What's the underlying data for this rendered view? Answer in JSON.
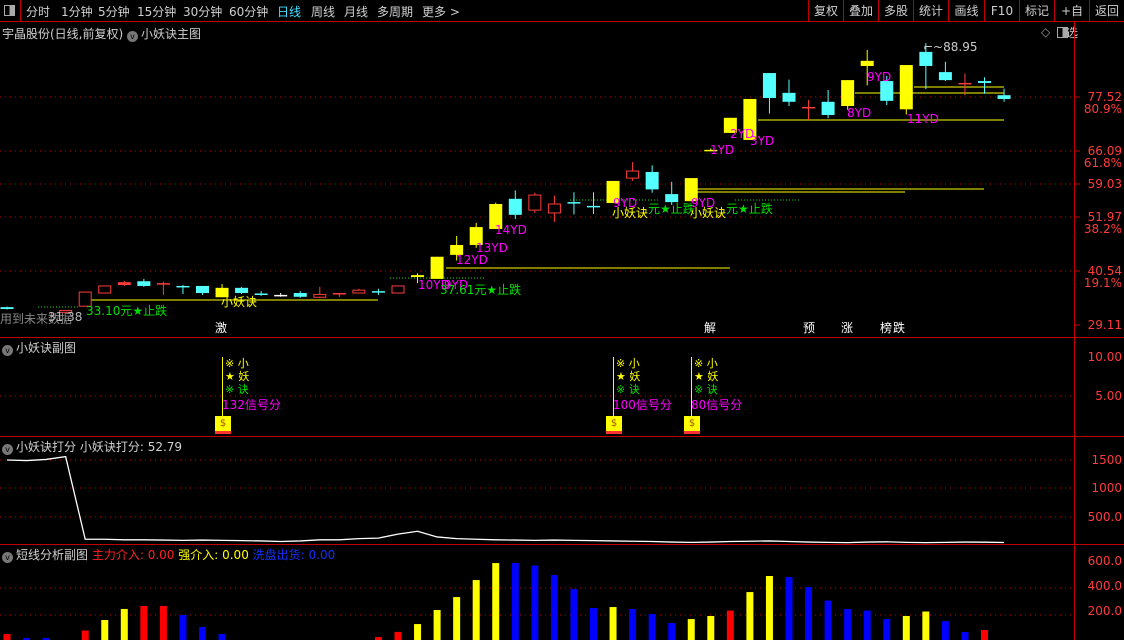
{
  "toolbar": {
    "periods": [
      "分时",
      "1分钟",
      "5分钟",
      "15分钟",
      "30分钟",
      "60分钟",
      "日线",
      "周线",
      "月线",
      "多周期",
      "更多 >"
    ],
    "active_period": "日线",
    "buttons": [
      "复权",
      "叠加",
      "多股",
      "统计",
      "画线",
      "F10",
      "标记",
      "+自选",
      "返回"
    ]
  },
  "main": {
    "stock_title": "宇晶股份(日线,前复权)",
    "indicator": "小妖诀主图",
    "price_axis": [
      "77.52",
      "80.9%",
      "66.09",
      "61.8%",
      "59.03",
      "51.97",
      "38.2%",
      "40.54",
      "19.1%",
      "29.11"
    ],
    "high_label": "88.95",
    "future_data_note": "用到未来数据",
    "low_label": "31.38",
    "labels": {
      "stop1": "33.10元★止跌",
      "xyj1": "小妖诀",
      "yd10": "10YD",
      "yd9a": "9YD",
      "stop2": "37.61元★止跌",
      "yd12": "12YD",
      "yd13": "13YD",
      "yd14": "14YD",
      "yd9b": "9YD",
      "xyj2": "小妖诀",
      "stop3": "元★止跌",
      "yd9c": "9YD",
      "xyj3": "小妖诀",
      "stop4": "元★止跌",
      "yd1": "1YD",
      "yd2": "2YD",
      "yd3": "3YD",
      "yd8": "8YD",
      "yd9d": "9YD",
      "yd11": "11YD"
    },
    "markers": [
      {
        "text": "激",
        "color": "#c04000"
      },
      {
        "text": "解",
        "color": "#008080"
      },
      {
        "text": "预",
        "color": "#a04000"
      },
      {
        "text": "涨",
        "color": "#900000"
      },
      {
        "text": "榜",
        "color": "#804000"
      },
      {
        "text": "跌",
        "color": "#008000"
      }
    ]
  },
  "sub1": {
    "title": "小妖诀副图",
    "axis": [
      "10.00",
      "5.00"
    ],
    "signal_lines": [
      "小",
      "妖",
      "诀"
    ],
    "signals": [
      {
        "index": 11,
        "score": "132信号分"
      },
      {
        "index": 31,
        "score": "100信号分"
      },
      {
        "index": 35,
        "score": "80信号分"
      }
    ]
  },
  "sub2": {
    "title": "小妖诀打分",
    "value_label": "小妖诀打分: 52.79",
    "axis": [
      "1500",
      "1000",
      "500.0"
    ]
  },
  "sub3": {
    "title": "短线分析副图",
    "main_in": "主力介入: 0.00",
    "strong_in": "强介入: 0.00",
    "wash_out": "洗盘出货: 0.00",
    "axis": [
      "600.0",
      "400.0",
      "200.0"
    ]
  },
  "colors": {
    "up": "#ff3c3c",
    "down": "#54ffff",
    "yellow": "#ffff00",
    "blue": "#0000ff",
    "grid": "#c00000"
  },
  "chart_data": [
    {
      "type": "candlestick",
      "name": "小妖诀主图",
      "ylim": [
        29.11,
        88.95
      ],
      "candles": [
        [
          0,
          32.9,
          32.5,
          33.0,
          32.4,
          "C"
        ],
        [
          3,
          32.2,
          31.8,
          32.3,
          31.6,
          "R"
        ],
        [
          4,
          36.1,
          33.1,
          36.1,
          33.1,
          "R"
        ],
        [
          5,
          37.4,
          35.9,
          37.4,
          35.9,
          "R"
        ],
        [
          6,
          38.2,
          37.6,
          38.5,
          37.4,
          "F"
        ],
        [
          7,
          38.4,
          37.4,
          38.9,
          37.2,
          "C"
        ],
        [
          8,
          38.0,
          37.8,
          38.3,
          35.5,
          "F"
        ],
        [
          9,
          37.4,
          37.3,
          37.6,
          35.7,
          "C"
        ],
        [
          10,
          37.4,
          35.9,
          37.4,
          35.5,
          "C"
        ],
        [
          11,
          37.0,
          35.0,
          37.8,
          35.0,
          "Y"
        ],
        [
          12,
          37.0,
          35.9,
          37.2,
          35.7,
          "C"
        ],
        [
          13,
          35.8,
          35.7,
          36.3,
          35.3,
          "C"
        ],
        [
          14,
          35.5,
          35.4,
          35.9,
          35.1,
          "W"
        ],
        [
          15,
          35.9,
          35.1,
          36.3,
          34.9,
          "C"
        ],
        [
          16,
          35.6,
          35.0,
          37.2,
          34.8,
          "R"
        ],
        [
          17,
          35.9,
          35.6,
          35.9,
          35.1,
          "F"
        ],
        [
          18,
          36.5,
          35.9,
          36.8,
          35.8,
          "R"
        ],
        [
          19,
          36.3,
          36.2,
          36.8,
          35.5,
          "C"
        ],
        [
          20,
          37.4,
          35.9,
          37.4,
          35.9,
          "R"
        ],
        [
          21,
          39.7,
          39.3,
          40.1,
          38.0,
          "Y"
        ],
        [
          22,
          43.6,
          38.9,
          43.6,
          38.9,
          "Y"
        ],
        [
          23,
          46.1,
          44.0,
          48.0,
          42.8,
          "Y"
        ],
        [
          24,
          49.9,
          46.1,
          50.8,
          45.5,
          "Y"
        ],
        [
          25,
          54.8,
          49.5,
          55.1,
          49.5,
          "Y"
        ],
        [
          26,
          55.9,
          52.5,
          57.7,
          51.6,
          "C"
        ],
        [
          27,
          56.7,
          53.5,
          57.2,
          52.9,
          "R"
        ],
        [
          28,
          54.8,
          52.9,
          56.6,
          51.0,
          "R"
        ],
        [
          29,
          55.2,
          55.0,
          57.3,
          52.6,
          "C"
        ],
        [
          30,
          54.4,
          54.2,
          57.3,
          52.7,
          "C"
        ],
        [
          31,
          59.7,
          55.0,
          59.7,
          55.0,
          "Y"
        ],
        [
          32,
          61.8,
          60.3,
          63.7,
          59.7,
          "R"
        ],
        [
          33,
          61.6,
          57.9,
          63.0,
          57.2,
          "C"
        ],
        [
          34,
          56.9,
          55.2,
          59.5,
          54.6,
          "C"
        ],
        [
          35,
          60.3,
          55.4,
          60.3,
          55.4,
          "Y"
        ],
        [
          36,
          66.3,
          66.2,
          66.6,
          66.0,
          "Y"
        ],
        [
          37,
          73.1,
          69.9,
          73.1,
          69.9,
          "Y"
        ],
        [
          38,
          77.1,
          68.4,
          77.1,
          68.4,
          "Y"
        ],
        [
          39,
          82.6,
          77.3,
          82.6,
          74.0,
          "C"
        ],
        [
          40,
          78.4,
          76.5,
          81.2,
          75.6,
          "C"
        ],
        [
          41,
          75.4,
          75.2,
          76.9,
          72.6,
          "F"
        ],
        [
          42,
          76.5,
          73.7,
          79.0,
          73.0,
          "C"
        ],
        [
          43,
          81.1,
          75.6,
          81.1,
          74.8,
          "Y"
        ],
        [
          44,
          85.2,
          84.1,
          87.5,
          80.0,
          "Y"
        ],
        [
          45,
          80.9,
          76.7,
          82.0,
          75.8,
          "C"
        ],
        [
          46,
          84.3,
          74.9,
          84.3,
          73.8,
          "Y"
        ],
        [
          47,
          87.1,
          84.1,
          88.95,
          79.2,
          "C"
        ],
        [
          48,
          82.8,
          81.1,
          85.0,
          80.9,
          "C"
        ],
        [
          49,
          80.5,
          80.3,
          82.5,
          77.9,
          "F"
        ],
        [
          50,
          80.9,
          80.5,
          81.7,
          78.2,
          "C"
        ],
        [
          51,
          77.9,
          77.1,
          79.3,
          76.5,
          "C"
        ]
      ]
    },
    {
      "type": "line",
      "name": "小妖诀打分",
      "ylim": [
        0,
        1700
      ],
      "values": [
        1500,
        1490,
        1510,
        1560,
        110,
        110,
        100,
        100,
        95,
        90,
        95,
        90,
        85,
        80,
        70,
        80,
        100,
        100,
        120,
        130,
        200,
        250,
        150,
        120,
        110,
        100,
        95,
        90,
        95,
        90,
        85,
        80,
        75,
        70,
        60,
        55,
        60,
        70,
        75,
        80,
        70,
        60,
        55,
        50,
        60,
        65,
        55,
        50,
        55,
        60,
        58,
        52.79
      ]
    },
    {
      "type": "bar",
      "name": "短线分析副图",
      "ylim": [
        0,
        700
      ],
      "bars": [
        [
          0,
          44,
          "red"
        ],
        [
          1,
          15,
          "blue"
        ],
        [
          2,
          15,
          "blue"
        ],
        [
          4,
          70,
          "red"
        ],
        [
          5,
          148,
          "yellow"
        ],
        [
          6,
          230,
          "yellow"
        ],
        [
          7,
          252,
          "red"
        ],
        [
          8,
          252,
          "red"
        ],
        [
          9,
          185,
          "blue"
        ],
        [
          10,
          96,
          "blue"
        ],
        [
          11,
          44,
          "blue"
        ],
        [
          19,
          22,
          "red"
        ],
        [
          20,
          60,
          "red"
        ],
        [
          21,
          118,
          "yellow"
        ],
        [
          22,
          222,
          "yellow"
        ],
        [
          23,
          318,
          "yellow"
        ],
        [
          24,
          444,
          "yellow"
        ],
        [
          25,
          570,
          "yellow"
        ],
        [
          26,
          570,
          "blue"
        ],
        [
          27,
          551,
          "blue"
        ],
        [
          28,
          481,
          "blue"
        ],
        [
          29,
          377,
          "blue"
        ],
        [
          30,
          237,
          "blue"
        ],
        [
          31,
          244,
          "yellow"
        ],
        [
          32,
          229,
          "blue"
        ],
        [
          33,
          192,
          "blue"
        ],
        [
          34,
          126,
          "blue"
        ],
        [
          35,
          155,
          "yellow"
        ],
        [
          36,
          178,
          "yellow"
        ],
        [
          37,
          218,
          "red"
        ],
        [
          38,
          355,
          "yellow"
        ],
        [
          39,
          474,
          "yellow"
        ],
        [
          40,
          466,
          "blue"
        ],
        [
          41,
          392,
          "blue"
        ],
        [
          42,
          292,
          "blue"
        ],
        [
          43,
          229,
          "blue"
        ],
        [
          44,
          218,
          "blue"
        ],
        [
          45,
          155,
          "blue"
        ],
        [
          46,
          178,
          "yellow"
        ],
        [
          47,
          211,
          "yellow"
        ],
        [
          48,
          140,
          "blue"
        ],
        [
          49,
          59,
          "blue"
        ],
        [
          50,
          74,
          "red"
        ]
      ]
    }
  ]
}
